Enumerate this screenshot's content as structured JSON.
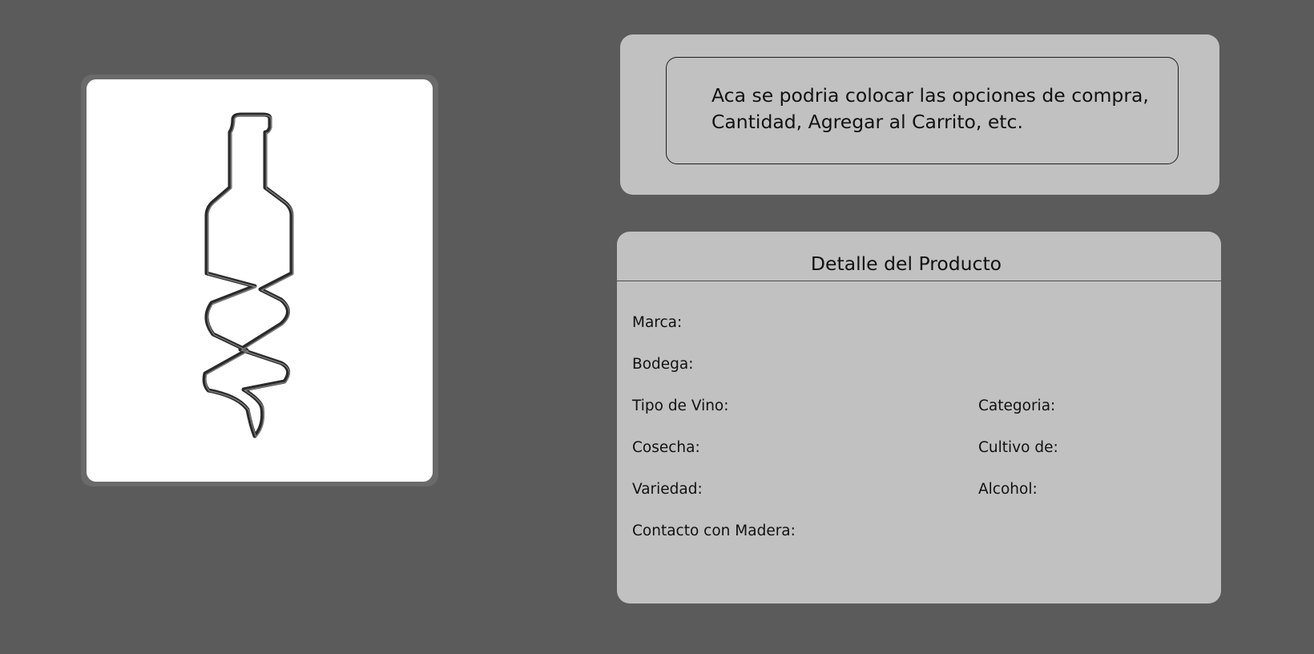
{
  "purchase": {
    "text_line1": "Aca se podria colocar las opciones de compra,",
    "text_line2": "Cantidad, Agregar al Carrito, etc."
  },
  "image": {
    "icon": "corkscrew-bottle-icon"
  },
  "detail": {
    "title": "Detalle del Producto",
    "fields": {
      "marca": "Marca:",
      "bodega": "Bodega:",
      "tipo_de_vino": "Tipo de Vino:",
      "categoria": "Categoria:",
      "cosecha": "Cosecha:",
      "cultivo_de": "Cultivo de:",
      "variedad": "Variedad:",
      "alcohol": "Alcohol:",
      "contacto_con_madera": "Contacto con Madera:"
    }
  },
  "colors": {
    "background": "#5b5b5b",
    "panel": "#c1c1c1",
    "image_card_border": "#6a6a6a",
    "image_card_fill": "#ffffff"
  }
}
